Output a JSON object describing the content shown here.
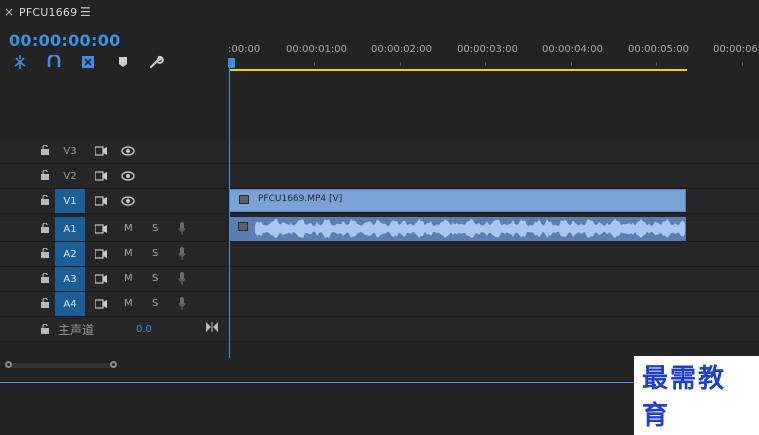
{
  "sequence": {
    "tab_close": "×",
    "tab_title": "PFCU1669",
    "tab_menu": "☰",
    "timecode": "00:00:00:00"
  },
  "toolbar": {
    "icons": [
      "snap-icon",
      "link-icon",
      "add-marker-icon",
      "marker-icon",
      "wrench-icon"
    ]
  },
  "ruler": {
    "labels": [
      ":00:00",
      "00:00:01:00",
      "00:00:02:00",
      "00:00:03:00",
      "00:00:04:00",
      "00:00:05:00",
      "00:00:06:"
    ]
  },
  "tracks": {
    "video": [
      {
        "name": "V3",
        "active": false
      },
      {
        "name": "V2",
        "active": false
      },
      {
        "name": "V1",
        "active": true
      }
    ],
    "audio": [
      {
        "name": "A1",
        "active": true,
        "m": "M",
        "s": "S"
      },
      {
        "name": "A2",
        "active": true,
        "m": "M",
        "s": "S"
      },
      {
        "name": "A3",
        "active": true,
        "m": "M",
        "s": "S"
      },
      {
        "name": "A4",
        "active": true,
        "m": "M",
        "s": "S"
      }
    ],
    "master": {
      "label": "主声道",
      "value": "0.0"
    }
  },
  "clips": {
    "video_label": "PFCU1669.MP4 [V]"
  },
  "watermark": "最需教育",
  "colors": {
    "accent": "#3a8fe6",
    "work_area": "#e5d800",
    "clip_video": "#7aa2d6",
    "clip_audio": "#5b7fb4",
    "active_track": "#1b5f96"
  }
}
